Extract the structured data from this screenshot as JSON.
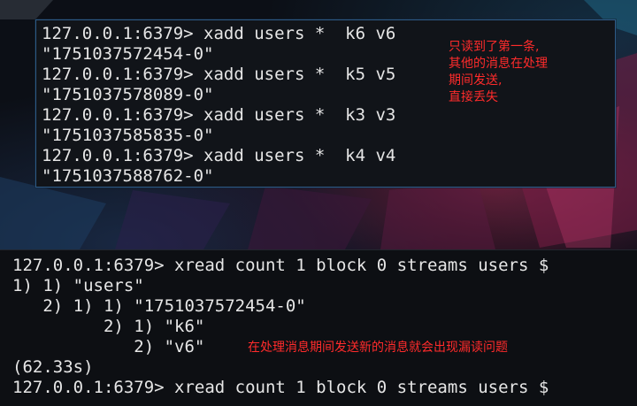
{
  "top_terminal": {
    "lines": [
      "127.0.0.1:6379> xadd users *  k6 v6",
      "\"1751037572454-0\"",
      "127.0.0.1:6379> xadd users *  k5 v5",
      "\"1751037578089-0\"",
      "127.0.0.1:6379> xadd users *  k3 v3",
      "\"1751037585835-0\"",
      "127.0.0.1:6379> xadd users *  k4 v4",
      "\"1751037588762-0\""
    ],
    "annotation": [
      "只读到了第一条,",
      "其他的消息在处理",
      "期间发送,",
      "直接丢失"
    ]
  },
  "bottom_terminal": {
    "lines": [
      "127.0.0.1:6379> xread count 1 block 0 streams users $",
      "1) 1) \"users\"",
      "   2) 1) 1) \"1751037572454-0\"",
      "         2) 1) \"k6\"",
      "            2) \"v6\"",
      "(62.33s)",
      "127.0.0.1:6379> xread count 1 block 0 streams users $"
    ],
    "annotation": "在处理消息期间发送新的消息就会出现漏读问题"
  },
  "colors": {
    "text": "#e6e6e6",
    "annotation": "#ff2b2b",
    "top_border": "#2e5a86"
  }
}
